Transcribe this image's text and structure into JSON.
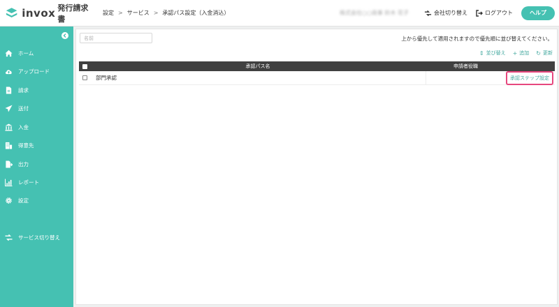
{
  "header": {
    "logo_word": "invox",
    "logo_sub": "発行請求書",
    "breadcrumb": [
      "設定",
      "サービス",
      "承認パス設定（入金消込）"
    ],
    "user_name": "株式会社○○商事 鈴木 花子",
    "switch_company": "会社切り替え",
    "logout": "ログアウト",
    "help": "ヘルプ"
  },
  "sidebar": {
    "items": [
      {
        "label": "ホーム",
        "icon": "home-icon"
      },
      {
        "label": "アップロード",
        "icon": "cloud-upload-icon"
      },
      {
        "label": "請求",
        "icon": "document-icon"
      },
      {
        "label": "送付",
        "icon": "send-icon"
      },
      {
        "label": "入金",
        "icon": "bank-icon"
      },
      {
        "label": "得意先",
        "icon": "building-icon"
      },
      {
        "label": "出力",
        "icon": "export-icon"
      },
      {
        "label": "レポート",
        "icon": "chart-icon"
      },
      {
        "label": "設定",
        "icon": "gear-icon"
      },
      {
        "label": "サービス切り替え",
        "icon": "switch-icon"
      }
    ]
  },
  "main": {
    "search_placeholder": "名前",
    "note": "上から優先して適用されますので優先順に並び替えてください。",
    "actions": {
      "sort": "並び替え",
      "add": "追加",
      "refresh": "更新"
    },
    "table": {
      "columns": [
        "承認パス名",
        "申請者役職"
      ],
      "rows": [
        {
          "name": "部門承認",
          "role": "",
          "button": "承認ステップ設定"
        }
      ]
    }
  },
  "colors": {
    "accent": "#45c1b2",
    "table_header": "#404040",
    "highlight": "#e6477e"
  }
}
